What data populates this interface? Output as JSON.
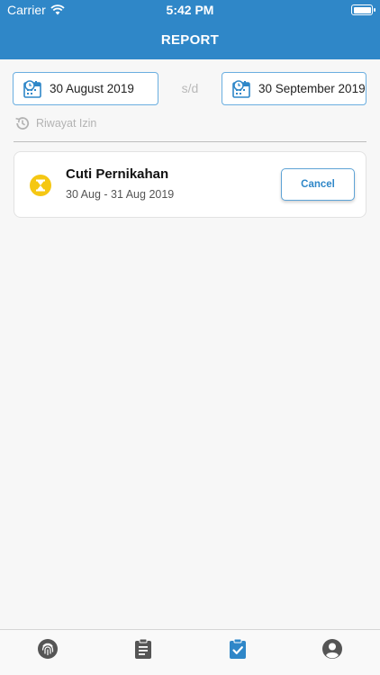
{
  "status_bar": {
    "carrier": "Carrier",
    "time": "5:42 PM"
  },
  "header": {
    "title": "REPORT"
  },
  "date_range": {
    "start": "30 August 2019",
    "separator": "s/d",
    "end": "30 September 2019"
  },
  "history_label": "Riwayat Izin",
  "leaves": [
    {
      "title": "Cuti Pernikahan",
      "dates": "30 Aug - 31 Aug 2019",
      "action": "Cancel",
      "status_icon": "hourglass-icon"
    }
  ],
  "tabbar": {
    "items": [
      {
        "icon": "fingerprint-icon",
        "active": false
      },
      {
        "icon": "clipboard-list-icon",
        "active": false
      },
      {
        "icon": "clipboard-check-icon",
        "active": true
      },
      {
        "icon": "user-circle-icon",
        "active": false
      }
    ]
  },
  "colors": {
    "primary": "#2f87c8",
    "badge": "#f5c713",
    "inactive_icon": "#555555"
  }
}
